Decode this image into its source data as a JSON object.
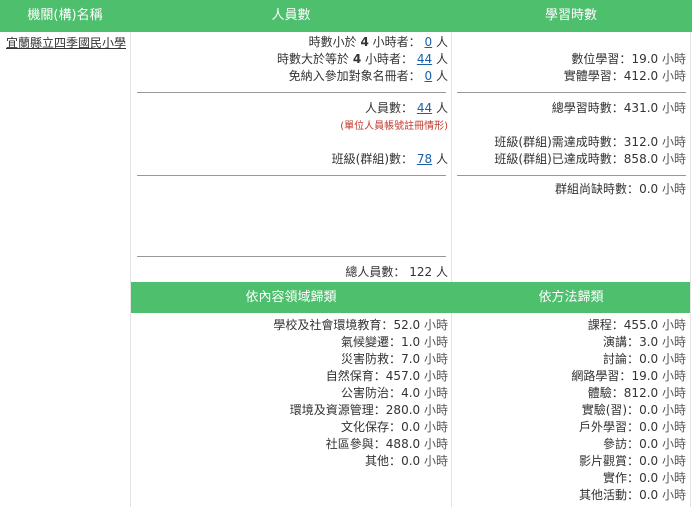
{
  "headers": {
    "agency": "機關(構)名稱",
    "people": "人員數",
    "hours": "學習時數",
    "by_content": "依內容領域歸類",
    "by_method": "依方法歸類"
  },
  "agency_name": "宜蘭縣立四季國民小學",
  "people": {
    "lt4_prefix": "時數小於",
    "lt4_num": "4",
    "lt4_suffix": "小時者：",
    "lt4_value": "0",
    "ge4_prefix": "時數大於等於",
    "ge4_num": "4",
    "ge4_suffix": "小時者：",
    "ge4_value": "44",
    "exempt_label": "免納入參加對象名冊者：",
    "exempt_value": "0",
    "unit": "人",
    "count_label": "人員數：",
    "count_value": "44",
    "note": "(單位人員帳號註冊情形)",
    "class_label": "班級(群組)數：",
    "class_value": "78",
    "total_label": "總人員數：",
    "total_value": "122"
  },
  "hours": {
    "digital_label": "數位學習：",
    "digital_value": "19.0",
    "physical_label": "實體學習：",
    "physical_value": "412.0",
    "unit": "小時",
    "total_label": "總學習時數：",
    "total_value": "431.0",
    "class_required_label": "班級(群組)需達成時數：",
    "class_required_value": "312.0",
    "class_done_label": "班級(群組)已達成時數：",
    "class_done_value": "858.0",
    "group_missing_label": "群組尚缺時數：",
    "group_missing_value": "0.0"
  },
  "content_items": [
    {
      "label": "學校及社會環境教育：",
      "value": "52.0"
    },
    {
      "label": "氣候變遷：",
      "value": "1.0"
    },
    {
      "label": "災害防救：",
      "value": "7.0"
    },
    {
      "label": "自然保育：",
      "value": "457.0"
    },
    {
      "label": "公害防治：",
      "value": "4.0"
    },
    {
      "label": "環境及資源管理：",
      "value": "280.0"
    },
    {
      "label": "文化保存：",
      "value": "0.0"
    },
    {
      "label": "社區參與：",
      "value": "488.0"
    },
    {
      "label": "其他：",
      "value": "0.0"
    }
  ],
  "method_items": [
    {
      "label": "課程：",
      "value": "455.0"
    },
    {
      "label": "演講：",
      "value": "3.0"
    },
    {
      "label": "討論：",
      "value": "0.0"
    },
    {
      "label": "網路學習：",
      "value": "19.0"
    },
    {
      "label": "體驗：",
      "value": "812.0"
    },
    {
      "label": "實驗(習)：",
      "value": "0.0"
    },
    {
      "label": "戶外學習：",
      "value": "0.0"
    },
    {
      "label": "參訪：",
      "value": "0.0"
    },
    {
      "label": "影片觀賞：",
      "value": "0.0"
    },
    {
      "label": "實作：",
      "value": "0.0"
    },
    {
      "label": "其他活動：",
      "value": "0.0"
    }
  ],
  "hour_unit": "小時",
  "colors": {
    "header": "#4dbf6d",
    "link": "#1a5fa8",
    "note": "#c0392b"
  }
}
